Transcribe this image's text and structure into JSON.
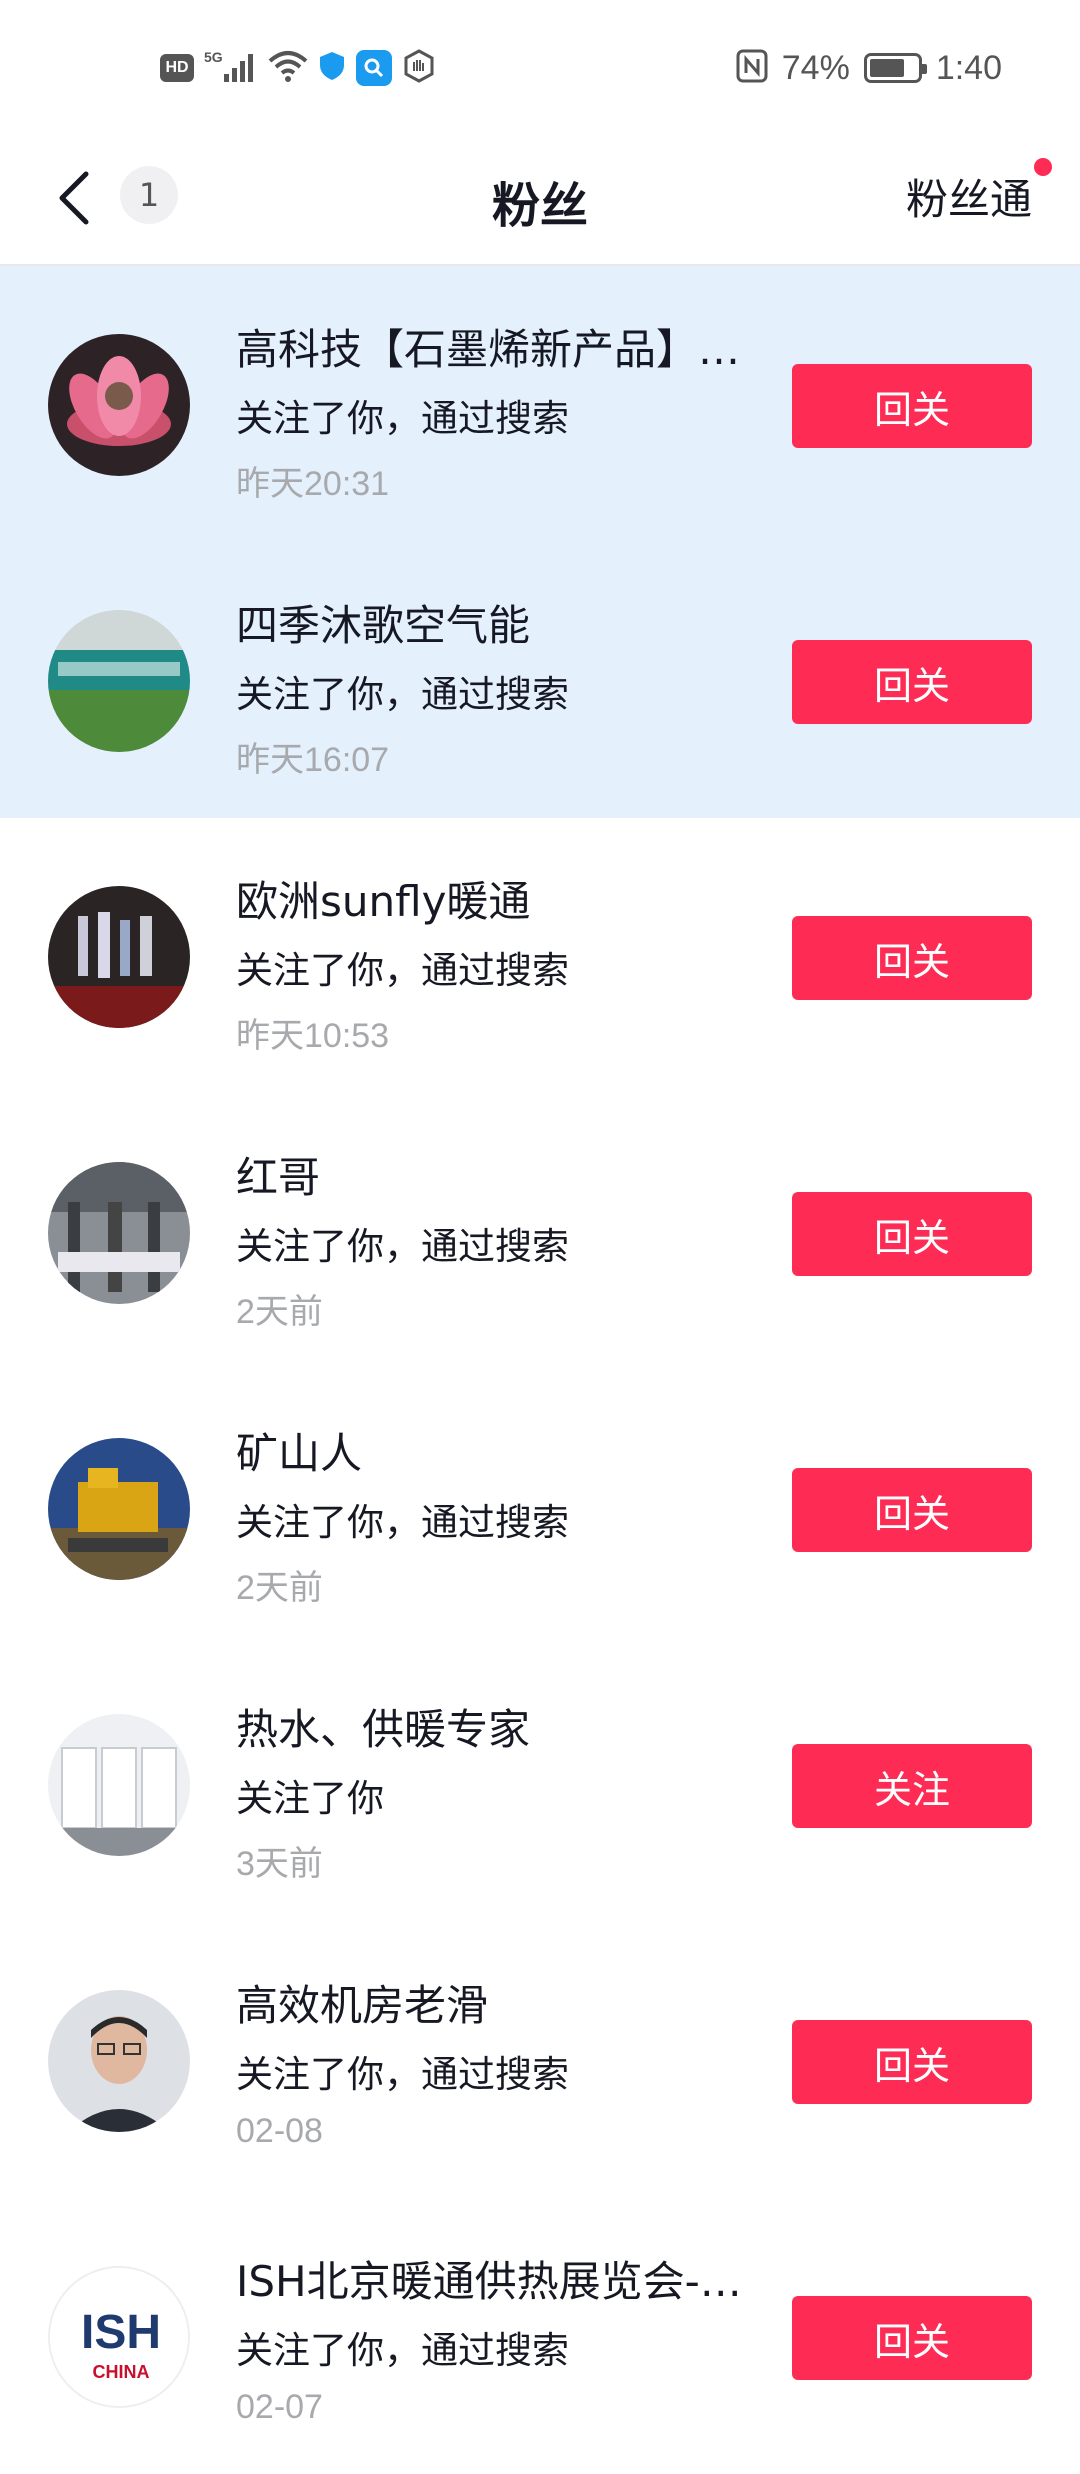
{
  "status_bar": {
    "left_badge": "HD",
    "network": "5G",
    "battery_percent": "74%",
    "battery_level": 0.74,
    "time": "1:40",
    "icons": [
      "hd-icon",
      "signal-icon",
      "wifi-icon",
      "shield-icon",
      "search-app-icon",
      "hand-icon",
      "nfc-icon",
      "battery-icon"
    ]
  },
  "header": {
    "unread_count": "1",
    "title": "粉丝",
    "right_link": "粉丝通"
  },
  "followers": [
    {
      "name": "高科技【石墨烯新产品】…",
      "subtitle": "关注了你，通过搜索",
      "time": "昨天20:31",
      "button": "回关",
      "highlighted": true
    },
    {
      "name": "四季沐歌空气能",
      "subtitle": "关注了你，通过搜索",
      "time": "昨天16:07",
      "button": "回关",
      "highlighted": true
    },
    {
      "name": "欧洲sunfly暖通",
      "subtitle": "关注了你，通过搜索",
      "time": "昨天10:53",
      "button": "回关",
      "highlighted": false
    },
    {
      "name": "红哥",
      "subtitle": "关注了你，通过搜索",
      "time": "2天前",
      "button": "回关",
      "highlighted": false
    },
    {
      "name": "矿山人",
      "subtitle": "关注了你，通过搜索",
      "time": "2天前",
      "button": "回关",
      "highlighted": false
    },
    {
      "name": "热水、供暖专家",
      "subtitle": "关注了你",
      "time": "3天前",
      "button": "关注",
      "highlighted": false
    },
    {
      "name": "高效机房老滑",
      "subtitle": "关注了你，通过搜索",
      "time": "02-08",
      "button": "回关",
      "highlighted": false
    },
    {
      "name": "ISH北京暖通供热展览会-…",
      "subtitle": "关注了你，通过搜索",
      "time": "02-07",
      "button": "回关",
      "highlighted": false
    }
  ],
  "avatar_texts": {
    "ish_logo": "ISH",
    "ish_sub": "CHINA"
  },
  "colors": {
    "accent": "#fe2c55",
    "highlight_bg": "#e5f0fd",
    "secondary_text": "#a7a9ad"
  }
}
